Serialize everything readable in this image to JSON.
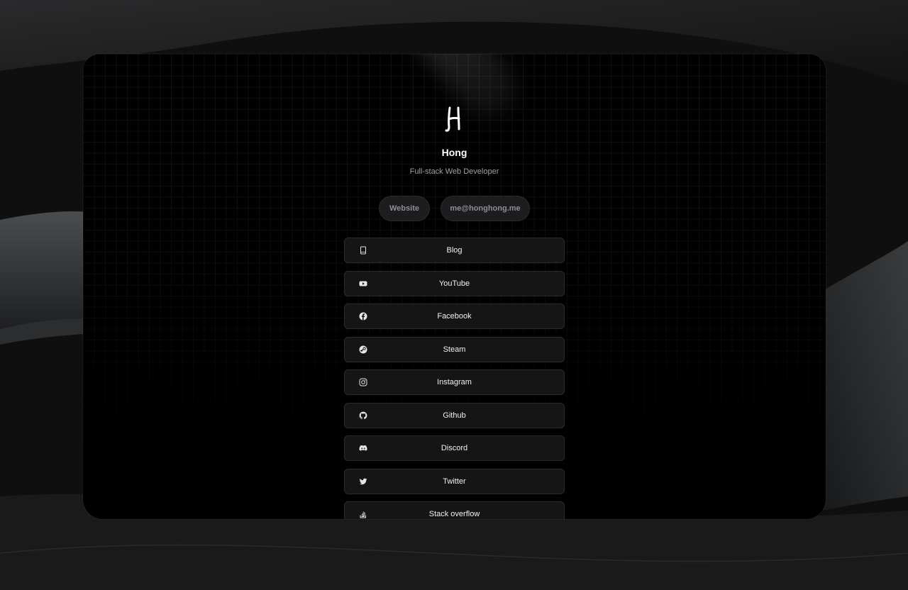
{
  "profile": {
    "name": "Hong",
    "subtitle": "Full-stack Web Developer"
  },
  "buttons": {
    "website": "Website",
    "email": "me@honghong.me"
  },
  "links": [
    {
      "label": "Blog",
      "icon": "book-icon"
    },
    {
      "label": "YouTube",
      "icon": "youtube-icon"
    },
    {
      "label": "Facebook",
      "icon": "facebook-icon"
    },
    {
      "label": "Steam",
      "icon": "steam-icon"
    },
    {
      "label": "Instagram",
      "icon": "instagram-icon"
    },
    {
      "label": "Github",
      "icon": "github-icon"
    },
    {
      "label": "Discord",
      "icon": "discord-icon"
    },
    {
      "label": "Twitter",
      "icon": "twitter-icon"
    },
    {
      "label": "Stack overflow",
      "icon": "stack-overflow-icon"
    }
  ],
  "colors": {
    "background": "#000000",
    "card": "#151516",
    "card_border": "#2b2b2e",
    "muted_text": "#a1a1a1",
    "pill": "#1d1d1f"
  }
}
